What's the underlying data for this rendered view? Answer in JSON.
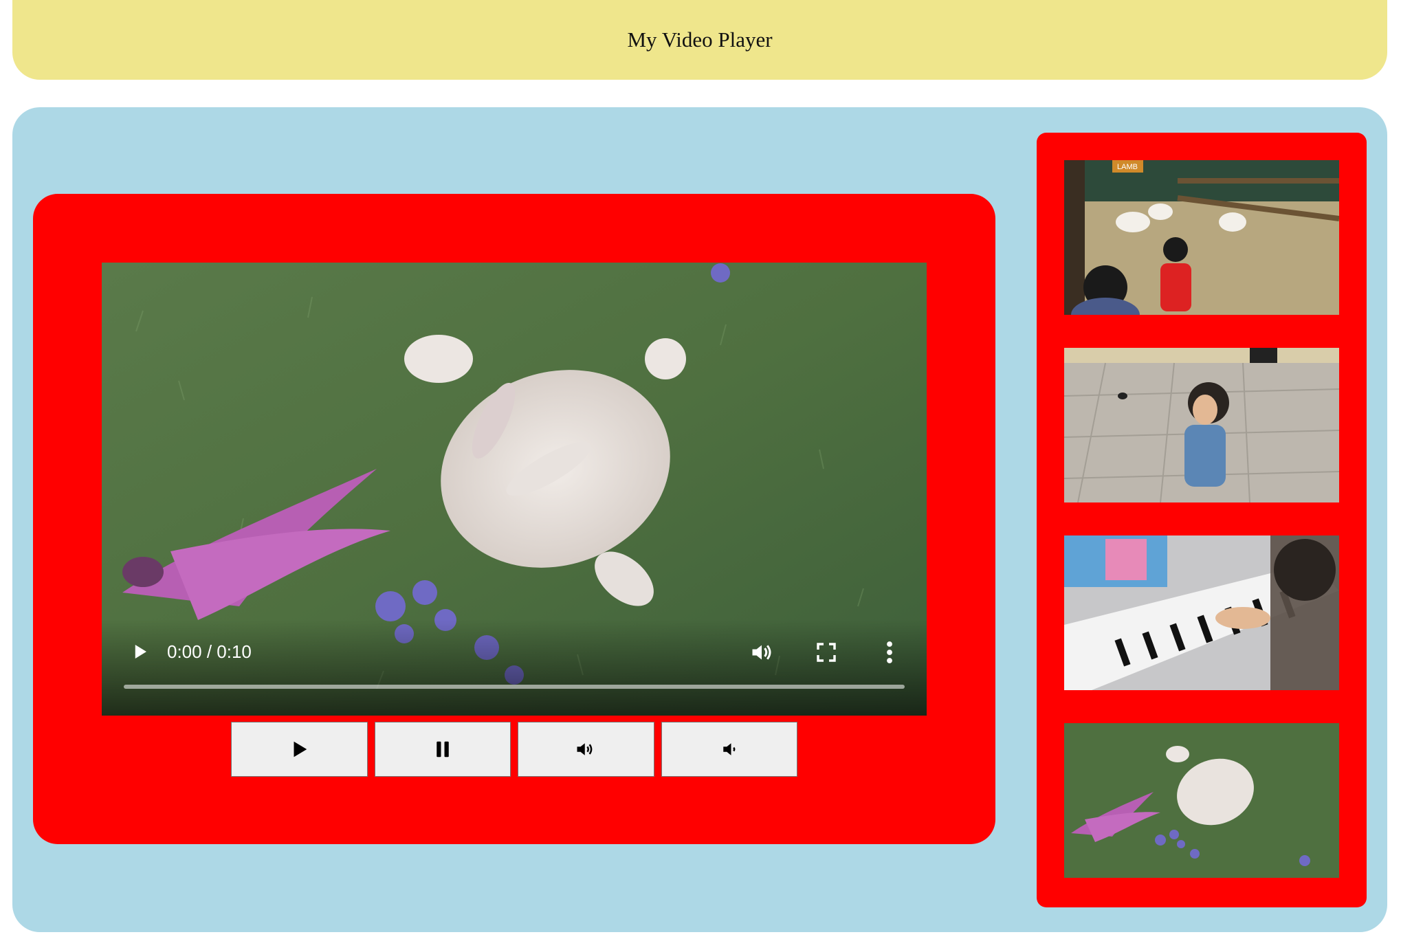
{
  "header": {
    "title": "My Video Player"
  },
  "player": {
    "time_display": "0:00 / 0:10",
    "progress_fraction": 0.0,
    "controls": {
      "play_icon": "play-icon",
      "volume_icon": "volume-icon",
      "fullscreen_icon": "fullscreen-icon",
      "more_icon": "more-options-icon"
    }
  },
  "buttons": [
    {
      "name": "play-button",
      "icon": "play-icon"
    },
    {
      "name": "pause-button",
      "icon": "pause-icon"
    },
    {
      "name": "volume-up-button",
      "icon": "volume-up-icon"
    },
    {
      "name": "volume-down-button",
      "icon": "volume-down-icon"
    }
  ],
  "playlist": {
    "items": [
      {
        "name": "thumb-lambs-petting-zoo",
        "scene": "children with lambs in pen",
        "sign_text": "LAMB"
      },
      {
        "name": "thumb-boy-plaza",
        "scene": "boy walking in stone plaza"
      },
      {
        "name": "thumb-boy-keyboard",
        "scene": "boy playing electronic keyboard"
      },
      {
        "name": "thumb-bunny-butterfly",
        "scene": "white rabbit and butterfly on grass"
      }
    ]
  },
  "colors": {
    "header_bg": "#efe68c",
    "stage_bg": "#add8e6",
    "panel_bg": "#ff0000",
    "button_bg": "#efefef"
  }
}
